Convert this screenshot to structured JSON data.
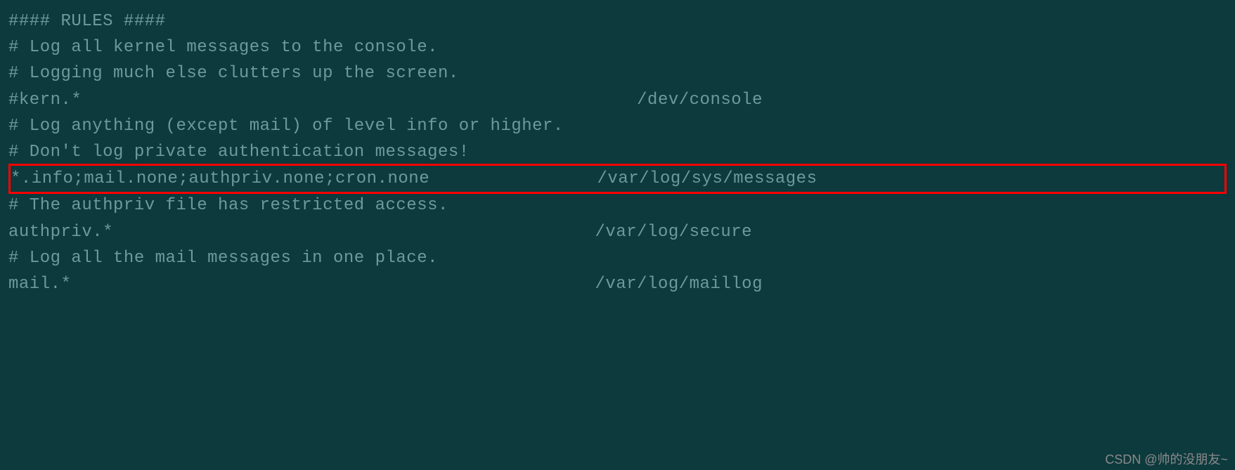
{
  "config": {
    "lines": [
      "#### RULES ####",
      "",
      "# Log all kernel messages to the console.",
      "# Logging much else clutters up the screen.",
      "#kern.*                                                     /dev/console",
      "",
      "# Log anything (except mail) of level info or higher.",
      "# Don't log private authentication messages!",
      "*.info;mail.none;authpriv.none;cron.none                /var/log/sys/messages",
      "",
      "# The authpriv file has restricted access.",
      "authpriv.*                                              /var/log/secure",
      "",
      "# Log all the mail messages in one place.",
      "mail.*                                                  /var/log/maillog"
    ],
    "highlighted_index": 8
  },
  "watermark": "CSDN @帅的没朋友~"
}
